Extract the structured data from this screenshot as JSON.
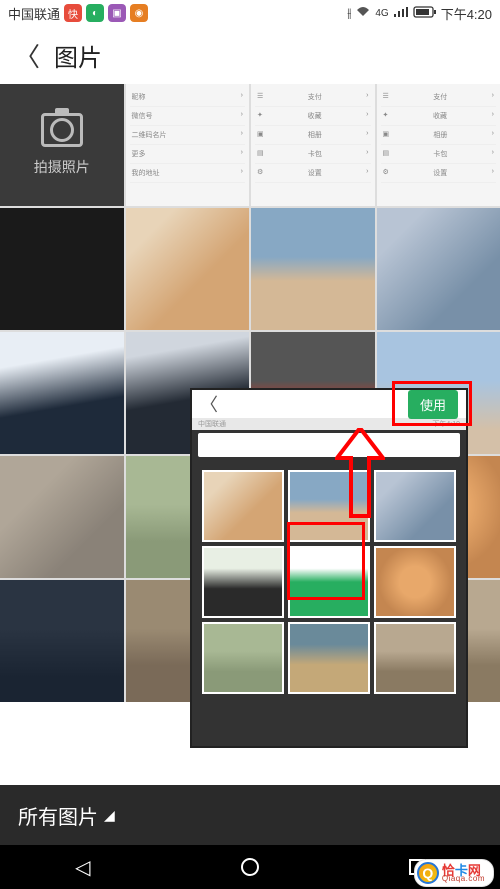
{
  "status": {
    "carrier": "中国联通",
    "net_label": "4G",
    "time": "下午4:20"
  },
  "header": {
    "title": "图片"
  },
  "camera": {
    "label": "拍摄照片"
  },
  "wechat_rows": [
    "昵称",
    "微信号",
    "二维码名片",
    "更多",
    "我的地址"
  ],
  "wechat_rows2": [
    "支付",
    "收藏",
    "相册",
    "卡包",
    "设置"
  ],
  "overlay": {
    "use_label": "使用",
    "status_left": "中国联通",
    "status_right": "下午4:19"
  },
  "bottom": {
    "label": "所有图片"
  },
  "watermark": {
    "name": "恰卡网",
    "sub": "Qiaqa.com"
  }
}
